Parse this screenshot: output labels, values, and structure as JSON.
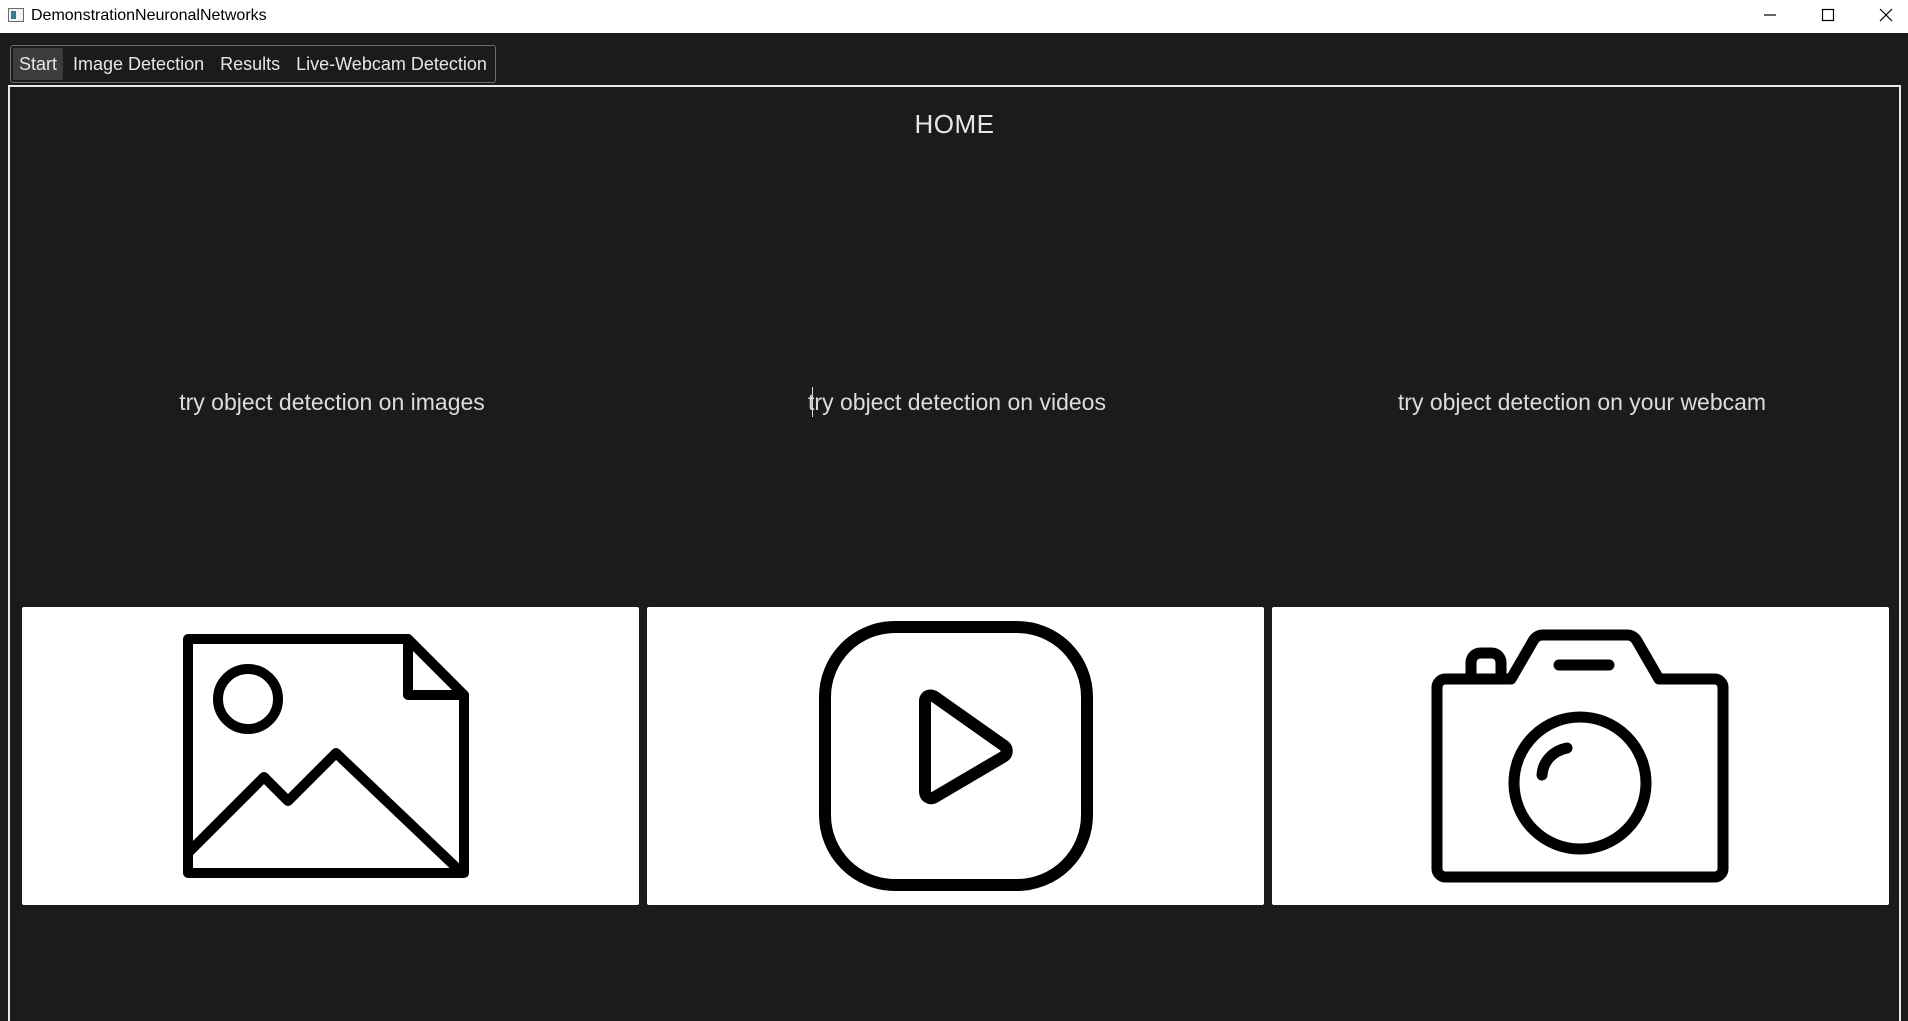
{
  "window": {
    "title": "DemonstrationNeuronalNetworks",
    "icon": "app-window-icon",
    "controls": [
      "minimize-icon",
      "maximize-icon",
      "close-icon"
    ]
  },
  "tabs": [
    {
      "label": "Start",
      "active": true
    },
    {
      "label": "Image Detection",
      "active": false
    },
    {
      "label": "Results",
      "active": false
    },
    {
      "label": "Live-Webcam Detection",
      "active": false
    }
  ],
  "home": {
    "title": "HOME",
    "options": [
      {
        "label": "try object detection on images",
        "icon": "image-file-icon"
      },
      {
        "label": "try object detection on videos",
        "icon": "play-video-icon"
      },
      {
        "label": "try object detection on your webcam",
        "icon": "camera-icon"
      }
    ]
  },
  "colors": {
    "background": "#1b1b1b",
    "text": "#e6e6e6",
    "card": "#ffffff",
    "icon_stroke": "#000000",
    "titlebar": "#ffffff"
  }
}
